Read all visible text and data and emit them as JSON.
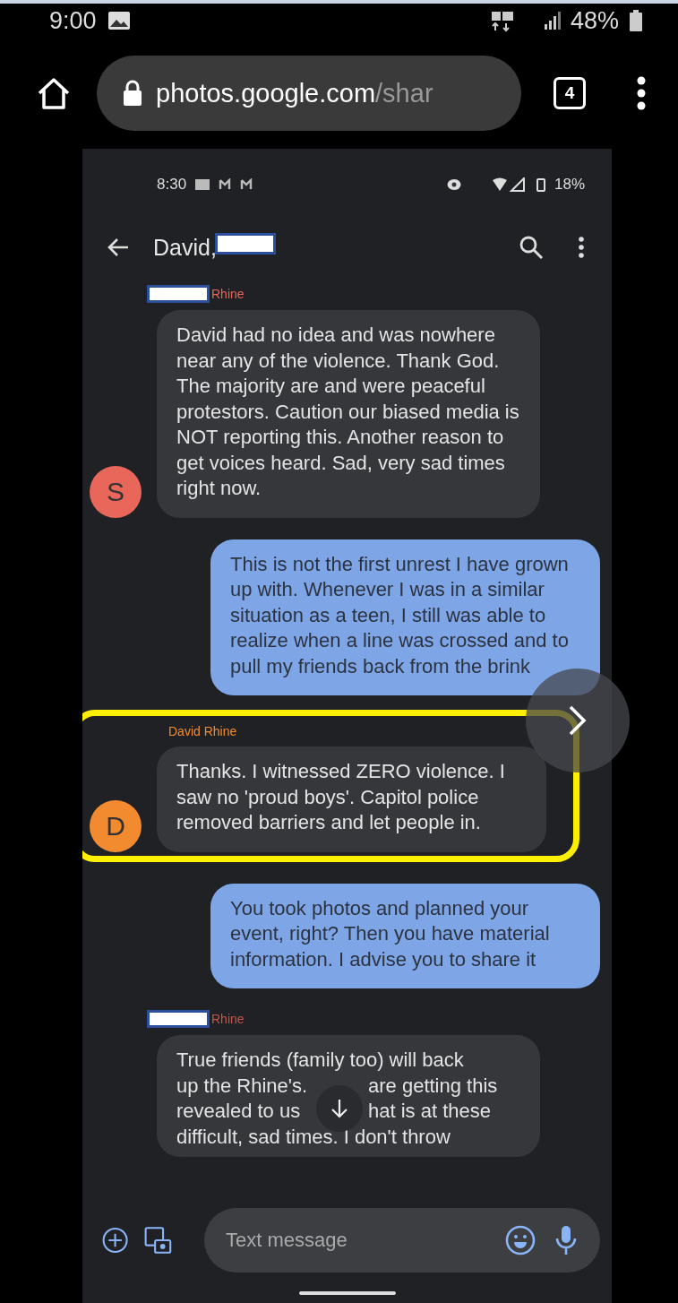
{
  "phone_status_bar": {
    "time": "9:00",
    "battery": "48%"
  },
  "browser": {
    "url_host": "photos.google.com",
    "url_path": "/shar",
    "tab_count": "4"
  },
  "screenshot": {
    "status_bar": {
      "time": "8:30",
      "battery": "18%"
    },
    "conversation_title": "David,",
    "messages": [
      {
        "kind": "received",
        "sender": "Rhine",
        "sender_redacted": true,
        "avatar": "S",
        "color": "#e8675a",
        "text": "David had no idea and was nowhere near any of the violence. Thank God. The majority are and were peaceful protestors. Caution our biased media is NOT reporting this. Another reason to get voices heard. Sad, very sad times right now."
      },
      {
        "kind": "sent",
        "text": "This is not the first unrest I have grown up with. Whenever I was in a similar situation as a teen, I still was able to realize when a line was crossed and to pull my friends back from the brink"
      },
      {
        "kind": "received",
        "sender": "David Rhine",
        "sender_redacted": false,
        "avatar": "D",
        "color": "#f28b30",
        "highlighted": true,
        "text": "Thanks.  I witnessed ZERO violence. I saw no 'proud boys'.  Capitol police removed barriers and let people in."
      },
      {
        "kind": "sent",
        "text": "You took photos and planned your event, right? Then you have material information. I advise you to share it"
      },
      {
        "kind": "received",
        "sender": "Rhine",
        "sender_redacted": true,
        "lines": [
          [
            "True friends (family too) will back"
          ],
          [
            "up the Rhine's.",
            "are getting this"
          ],
          [
            "revealed to us",
            "hat is at these"
          ],
          [
            "difficult, sad times. I don't throw"
          ]
        ]
      }
    ],
    "compose": {
      "placeholder": "Text message"
    }
  }
}
